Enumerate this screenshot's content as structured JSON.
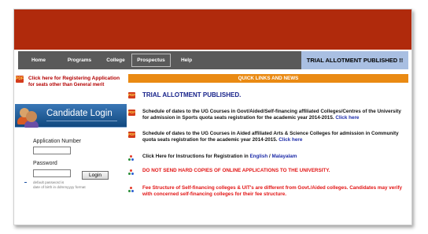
{
  "nav": {
    "items": [
      "Home",
      "Programs",
      "College",
      "Prospectus",
      "Help"
    ],
    "status": "TRIAL ALLOTMENT PUBLISHED !!"
  },
  "left": {
    "register_link": "Click here",
    "register_text": "for Registering Application",
    "register_text2": "for seats other than General merit",
    "login_title": "Candidate Login",
    "app_label": "Application Number",
    "pwd_label": "Password",
    "login_button": "Login",
    "hint_line1": "default password is",
    "hint_line2": "date of birth in ddmmyyyy format"
  },
  "quick": {
    "header": "QUICK LINKS AND NEWS",
    "trial": "TRIAL ALLOTMENT PUBLISHED.",
    "sports": "Schedule of dates to the UG Courses in Govt/Aided/Self-financing affiliated Colleges/Centres of the University for admission in Sports quota seats registration for the academic year 2014-2015.",
    "community": "Schedule of dates to the UG Courses in Aided affiliated Arts & Science Colleges for admission in Community quota seats registration for the academic year 2014-2015.",
    "click_here": "Click here",
    "instructions": "Click Here for Instructions for Registration in",
    "english": "English",
    "sep": "/",
    "malayalam": "Malayalam",
    "hard_copies": "DO NOT SEND HARD COPIES OF ONLINE APPLICATIONS TO THE UNIVERSITY.",
    "fee": "Fee Structure of Self-financing colleges & UIT's are different from Govt./Aided colleges. Candidates may verify with concerned self-financing colleges for their fee structure."
  },
  "colors": {
    "banner": "#b02a0c",
    "nav": "#5a5a5a",
    "status": "#a9bfe2",
    "quick_header": "#ea8a13"
  }
}
